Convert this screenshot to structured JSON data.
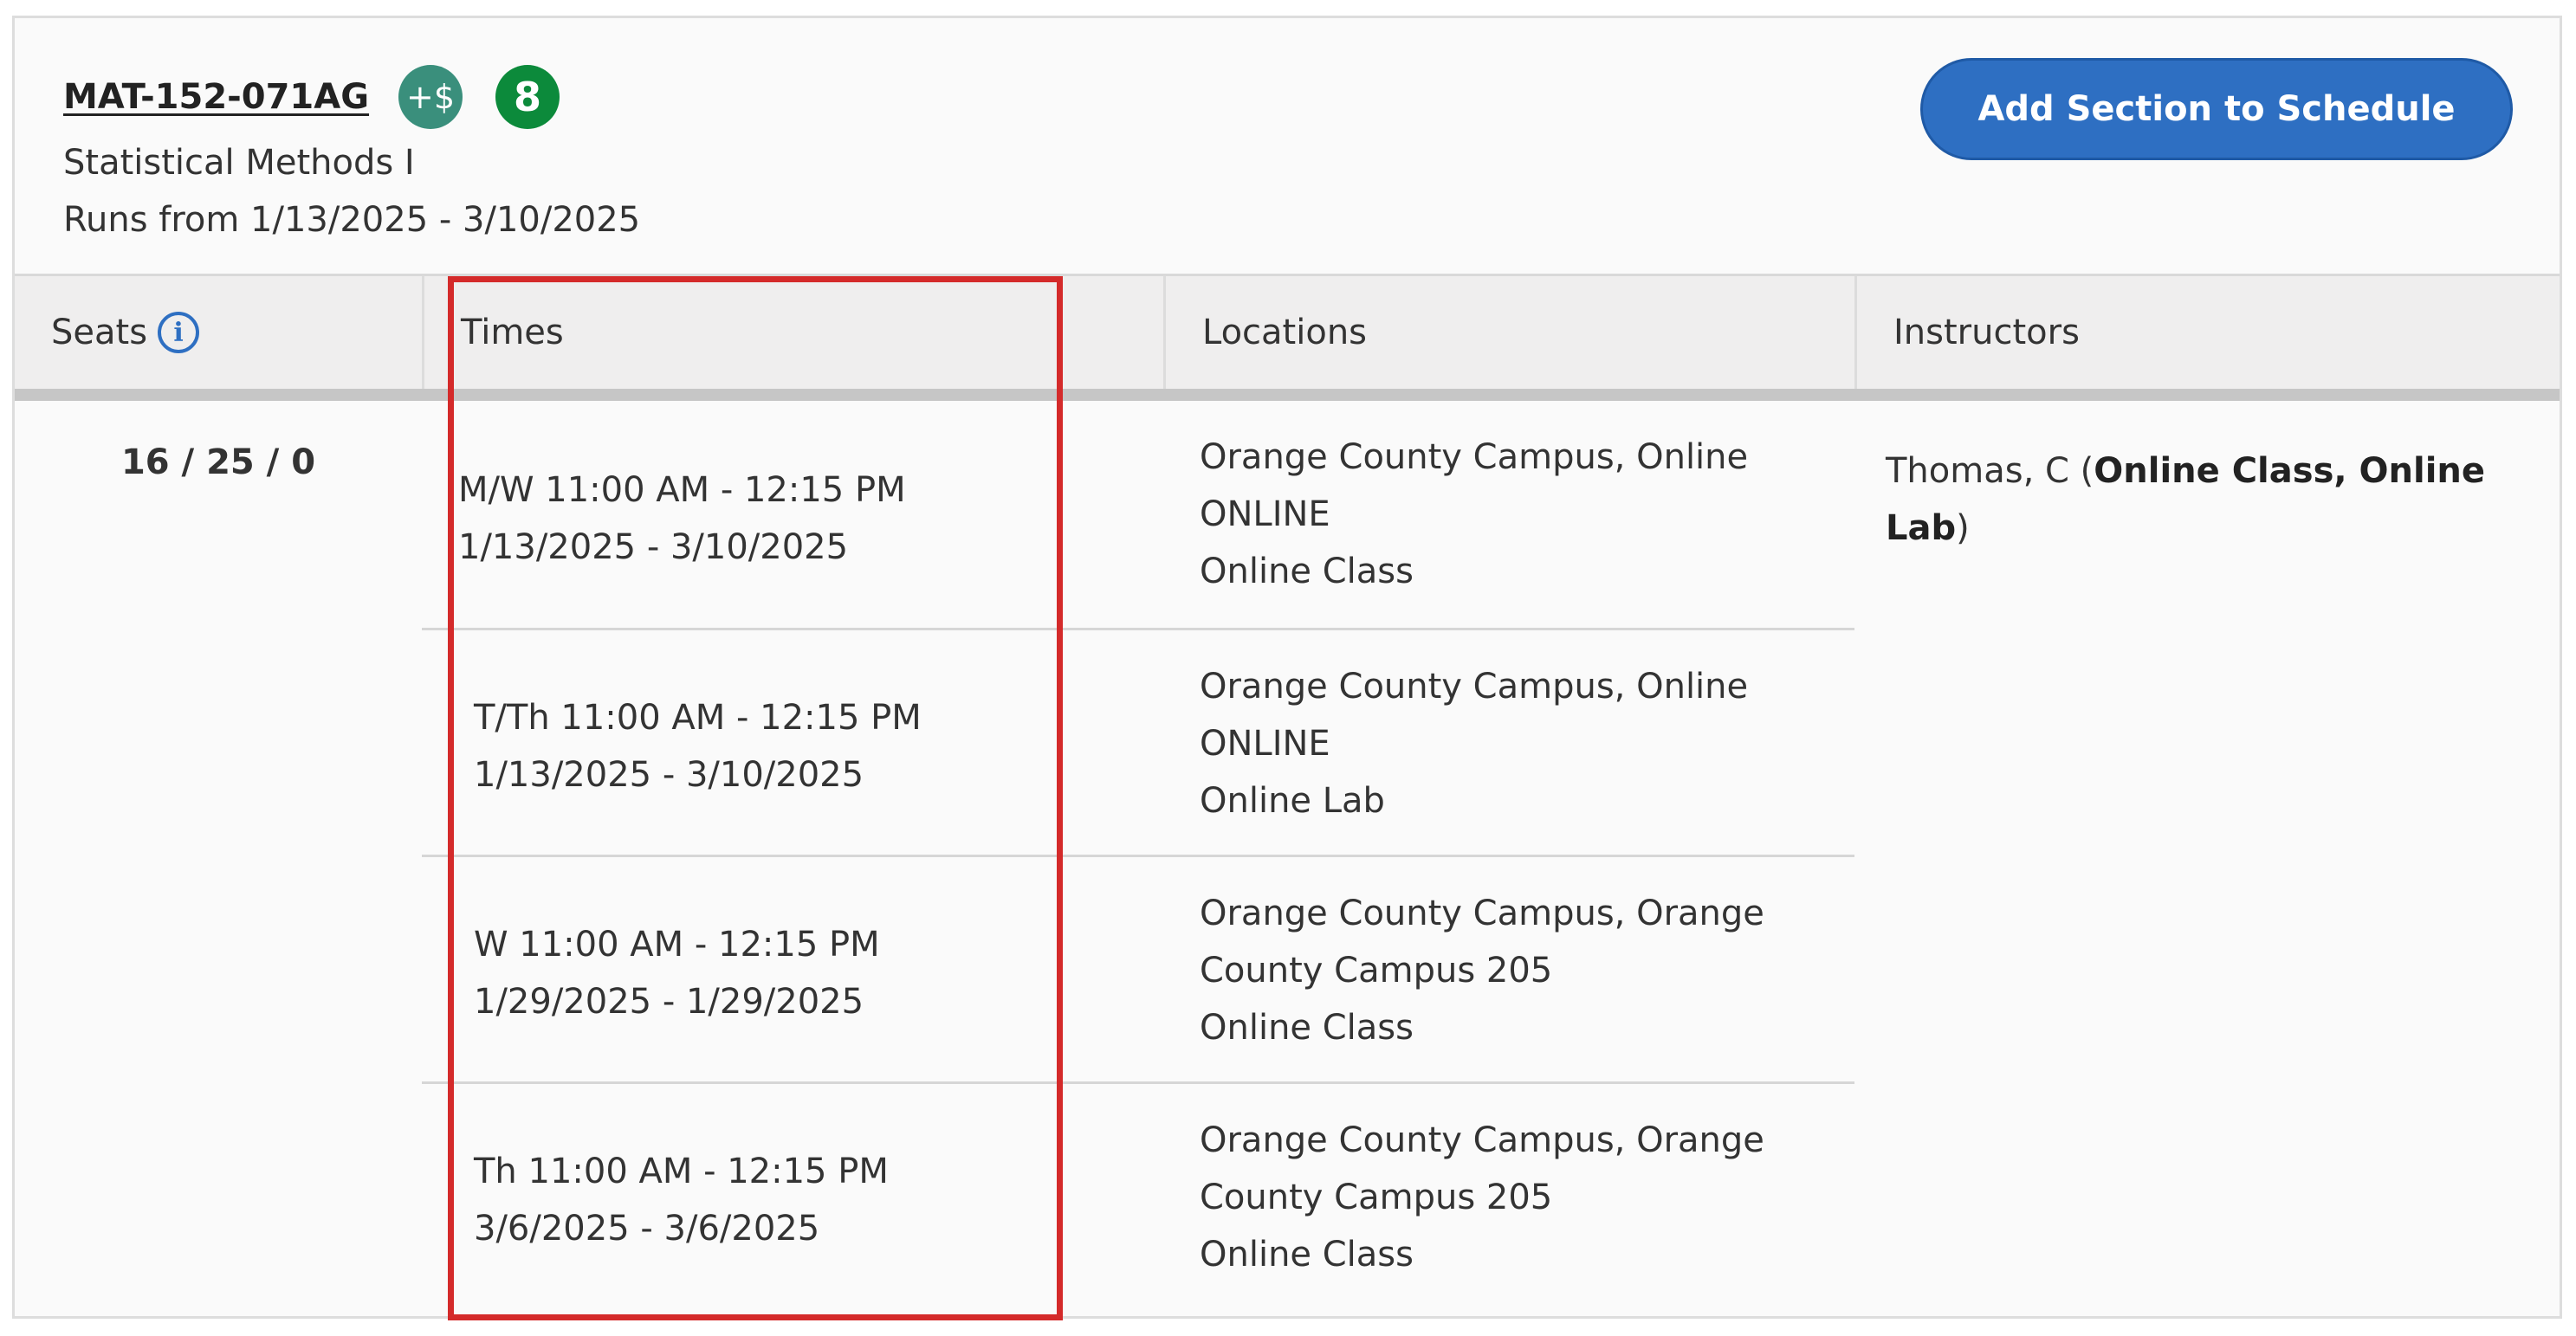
{
  "course": {
    "code": "MAT-152-071AG",
    "cost_badge": "+$",
    "count_badge": "8",
    "title": "Statistical Methods I",
    "runs": "Runs from 1/13/2025 - 3/10/2025"
  },
  "actions": {
    "add_section_label": "Add Section to Schedule"
  },
  "table": {
    "headers": {
      "seats": "Seats",
      "times": "Times",
      "locations": "Locations",
      "instructors": "Instructors"
    },
    "seats": "16 / 25 / 0",
    "rows": [
      {
        "time": "M/W 11:00 AM - 12:15 PM",
        "dates": "1/13/2025 - 3/10/2025",
        "location_1": "Orange County Campus, Online",
        "location_2": "ONLINE",
        "location_3": "Online Class"
      },
      {
        "time": "T/Th 11:00 AM - 12:15 PM",
        "dates": "1/13/2025 - 3/10/2025",
        "location_1": "Orange County Campus, Online",
        "location_2": "ONLINE",
        "location_3": "Online Lab"
      },
      {
        "time": "W 11:00 AM - 12:15 PM",
        "dates": "1/29/2025 - 1/29/2025",
        "location_1": "Orange County Campus, Orange",
        "location_2": "County Campus 205",
        "location_3": "Online Class"
      },
      {
        "time": "Th 11:00 AM - 12:15 PM",
        "dates": "3/6/2025 - 3/6/2025",
        "location_1": "Orange County Campus, Orange",
        "location_2": "County Campus 205",
        "location_3": "Online Class"
      }
    ],
    "instructor": {
      "name": "Thomas, C (",
      "methods_line_1": "Online Class, Online",
      "methods_line_2": "Lab",
      "close_paren": ")"
    }
  },
  "colors": {
    "primary_button": "#2e6fc2",
    "cost_badge": "#3a8f7c",
    "count_badge": "#0c8a3b",
    "highlight": "#d42a2a"
  },
  "icons": {
    "seats_info": "info-icon"
  }
}
